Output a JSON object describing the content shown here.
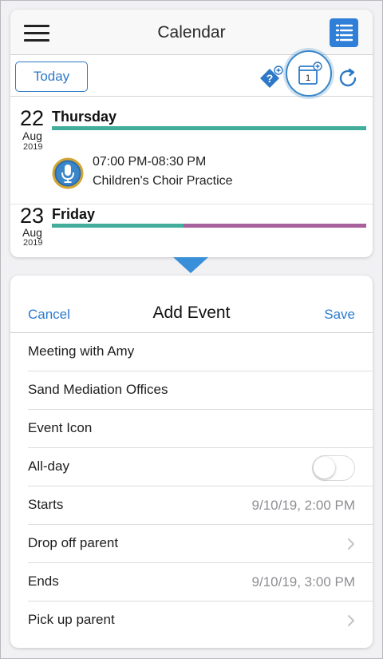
{
  "nav": {
    "title": "Calendar",
    "menu_icon": "hamburger-icon",
    "list_icon": "list-view-icon"
  },
  "toolbar": {
    "today_label": "Today",
    "icons": [
      "add-reminder-icon",
      "add-calendar-event-icon",
      "refresh-icon"
    ],
    "add_event_badge": "1"
  },
  "days": [
    {
      "day": "22",
      "month": "Aug",
      "year": "2019",
      "weekday": "Thursday",
      "bar_colors": [
        "#43ad9b"
      ],
      "events": [
        {
          "time": "07:00 PM-08:30 PM",
          "title": "Children's Choir Practice",
          "icon": "microphone-icon"
        }
      ]
    },
    {
      "day": "23",
      "month": "Aug",
      "year": "2019",
      "weekday": "Friday",
      "bar_colors": [
        "#43ad9b",
        "#a6609c"
      ],
      "events": []
    }
  ],
  "sheet": {
    "cancel_label": "Cancel",
    "title": "Add Event",
    "save_label": "Save",
    "rows": [
      {
        "label": "Meeting with Amy",
        "value": "",
        "accessory": "none"
      },
      {
        "label": "Sand Mediation Offices",
        "value": "",
        "accessory": "none"
      },
      {
        "label": "Event Icon",
        "value": "",
        "accessory": "none"
      },
      {
        "label": "All-day",
        "value": "",
        "accessory": "toggle",
        "toggle_on": false
      },
      {
        "label": "Starts",
        "value": "9/10/19, 2:00 PM",
        "accessory": "none"
      },
      {
        "label": "Drop off parent",
        "value": "",
        "accessory": "chevron"
      },
      {
        "label": "Ends",
        "value": "9/10/19, 3:00 PM",
        "accessory": "none"
      },
      {
        "label": "Pick up parent",
        "value": "",
        "accessory": "chevron"
      }
    ]
  },
  "colors": {
    "accent": "#2b7ad0",
    "teal": "#43ad9b",
    "purple": "#a6609c",
    "pointer": "#3a8fd9"
  }
}
